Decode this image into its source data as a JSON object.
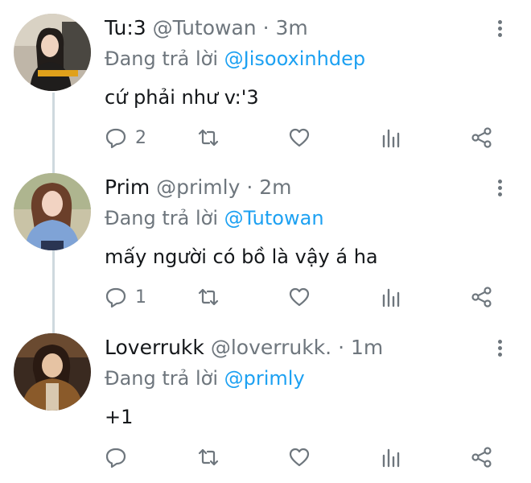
{
  "colors": {
    "accent": "#1da1f2",
    "muted": "#6e767d",
    "text": "#14171a"
  },
  "tweets": [
    {
      "name": "Tu:3",
      "handle": "@Tutowan",
      "separator": "·",
      "time": "3m",
      "reply_prefix": "Đang trả lời",
      "reply_to": "@Jisooxinhdep",
      "text": "cứ phải như v:'3",
      "reply_count": "2",
      "retweet_count": "",
      "like_count": ""
    },
    {
      "name": "Prim",
      "handle": "@primly",
      "separator": "·",
      "time": "2m",
      "reply_prefix": "Đang trả lời",
      "reply_to": "@Tutowan",
      "text": "mấy người có bồ là vậy á ha",
      "reply_count": "1",
      "retweet_count": "",
      "like_count": ""
    },
    {
      "name": "Loverrukk",
      "handle": "@loverrukk.",
      "separator": "·",
      "time": "1m",
      "reply_prefix": "Đang trả lời",
      "reply_to": "@primly",
      "text": "+1",
      "reply_count": "",
      "retweet_count": "",
      "like_count": ""
    }
  ],
  "icons": {
    "reply": "reply-icon",
    "retweet": "retweet-icon",
    "like": "heart-icon",
    "stats": "analytics-icon",
    "share": "share-icon",
    "more": "more-options-icon"
  }
}
